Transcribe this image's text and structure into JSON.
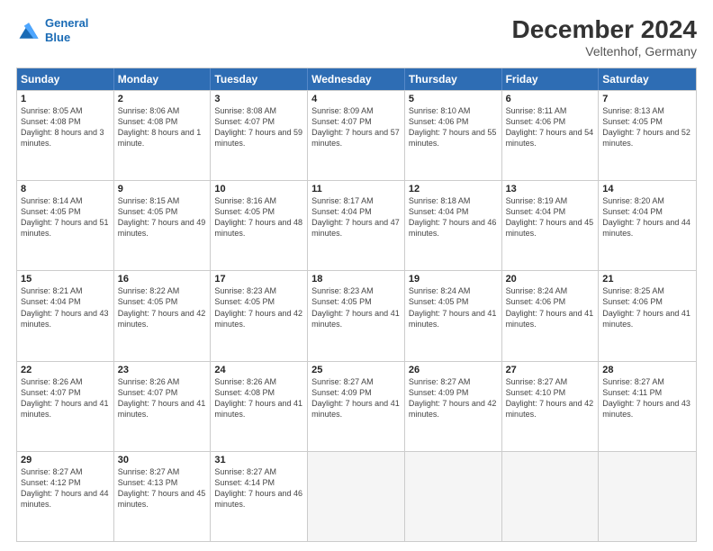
{
  "logo": {
    "line1": "General",
    "line2": "Blue"
  },
  "title": "December 2024",
  "location": "Veltenhof, Germany",
  "days_of_week": [
    "Sunday",
    "Monday",
    "Tuesday",
    "Wednesday",
    "Thursday",
    "Friday",
    "Saturday"
  ],
  "weeks": [
    [
      {
        "day": "1",
        "sunrise": "Sunrise: 8:05 AM",
        "sunset": "Sunset: 4:08 PM",
        "daylight": "Daylight: 8 hours and 3 minutes."
      },
      {
        "day": "2",
        "sunrise": "Sunrise: 8:06 AM",
        "sunset": "Sunset: 4:08 PM",
        "daylight": "Daylight: 8 hours and 1 minute."
      },
      {
        "day": "3",
        "sunrise": "Sunrise: 8:08 AM",
        "sunset": "Sunset: 4:07 PM",
        "daylight": "Daylight: 7 hours and 59 minutes."
      },
      {
        "day": "4",
        "sunrise": "Sunrise: 8:09 AM",
        "sunset": "Sunset: 4:07 PM",
        "daylight": "Daylight: 7 hours and 57 minutes."
      },
      {
        "day": "5",
        "sunrise": "Sunrise: 8:10 AM",
        "sunset": "Sunset: 4:06 PM",
        "daylight": "Daylight: 7 hours and 55 minutes."
      },
      {
        "day": "6",
        "sunrise": "Sunrise: 8:11 AM",
        "sunset": "Sunset: 4:06 PM",
        "daylight": "Daylight: 7 hours and 54 minutes."
      },
      {
        "day": "7",
        "sunrise": "Sunrise: 8:13 AM",
        "sunset": "Sunset: 4:05 PM",
        "daylight": "Daylight: 7 hours and 52 minutes."
      }
    ],
    [
      {
        "day": "8",
        "sunrise": "Sunrise: 8:14 AM",
        "sunset": "Sunset: 4:05 PM",
        "daylight": "Daylight: 7 hours and 51 minutes."
      },
      {
        "day": "9",
        "sunrise": "Sunrise: 8:15 AM",
        "sunset": "Sunset: 4:05 PM",
        "daylight": "Daylight: 7 hours and 49 minutes."
      },
      {
        "day": "10",
        "sunrise": "Sunrise: 8:16 AM",
        "sunset": "Sunset: 4:05 PM",
        "daylight": "Daylight: 7 hours and 48 minutes."
      },
      {
        "day": "11",
        "sunrise": "Sunrise: 8:17 AM",
        "sunset": "Sunset: 4:04 PM",
        "daylight": "Daylight: 7 hours and 47 minutes."
      },
      {
        "day": "12",
        "sunrise": "Sunrise: 8:18 AM",
        "sunset": "Sunset: 4:04 PM",
        "daylight": "Daylight: 7 hours and 46 minutes."
      },
      {
        "day": "13",
        "sunrise": "Sunrise: 8:19 AM",
        "sunset": "Sunset: 4:04 PM",
        "daylight": "Daylight: 7 hours and 45 minutes."
      },
      {
        "day": "14",
        "sunrise": "Sunrise: 8:20 AM",
        "sunset": "Sunset: 4:04 PM",
        "daylight": "Daylight: 7 hours and 44 minutes."
      }
    ],
    [
      {
        "day": "15",
        "sunrise": "Sunrise: 8:21 AM",
        "sunset": "Sunset: 4:04 PM",
        "daylight": "Daylight: 7 hours and 43 minutes."
      },
      {
        "day": "16",
        "sunrise": "Sunrise: 8:22 AM",
        "sunset": "Sunset: 4:05 PM",
        "daylight": "Daylight: 7 hours and 42 minutes."
      },
      {
        "day": "17",
        "sunrise": "Sunrise: 8:23 AM",
        "sunset": "Sunset: 4:05 PM",
        "daylight": "Daylight: 7 hours and 42 minutes."
      },
      {
        "day": "18",
        "sunrise": "Sunrise: 8:23 AM",
        "sunset": "Sunset: 4:05 PM",
        "daylight": "Daylight: 7 hours and 41 minutes."
      },
      {
        "day": "19",
        "sunrise": "Sunrise: 8:24 AM",
        "sunset": "Sunset: 4:05 PM",
        "daylight": "Daylight: 7 hours and 41 minutes."
      },
      {
        "day": "20",
        "sunrise": "Sunrise: 8:24 AM",
        "sunset": "Sunset: 4:06 PM",
        "daylight": "Daylight: 7 hours and 41 minutes."
      },
      {
        "day": "21",
        "sunrise": "Sunrise: 8:25 AM",
        "sunset": "Sunset: 4:06 PM",
        "daylight": "Daylight: 7 hours and 41 minutes."
      }
    ],
    [
      {
        "day": "22",
        "sunrise": "Sunrise: 8:26 AM",
        "sunset": "Sunset: 4:07 PM",
        "daylight": "Daylight: 7 hours and 41 minutes."
      },
      {
        "day": "23",
        "sunrise": "Sunrise: 8:26 AM",
        "sunset": "Sunset: 4:07 PM",
        "daylight": "Daylight: 7 hours and 41 minutes."
      },
      {
        "day": "24",
        "sunrise": "Sunrise: 8:26 AM",
        "sunset": "Sunset: 4:08 PM",
        "daylight": "Daylight: 7 hours and 41 minutes."
      },
      {
        "day": "25",
        "sunrise": "Sunrise: 8:27 AM",
        "sunset": "Sunset: 4:09 PM",
        "daylight": "Daylight: 7 hours and 41 minutes."
      },
      {
        "day": "26",
        "sunrise": "Sunrise: 8:27 AM",
        "sunset": "Sunset: 4:09 PM",
        "daylight": "Daylight: 7 hours and 42 minutes."
      },
      {
        "day": "27",
        "sunrise": "Sunrise: 8:27 AM",
        "sunset": "Sunset: 4:10 PM",
        "daylight": "Daylight: 7 hours and 42 minutes."
      },
      {
        "day": "28",
        "sunrise": "Sunrise: 8:27 AM",
        "sunset": "Sunset: 4:11 PM",
        "daylight": "Daylight: 7 hours and 43 minutes."
      }
    ],
    [
      {
        "day": "29",
        "sunrise": "Sunrise: 8:27 AM",
        "sunset": "Sunset: 4:12 PM",
        "daylight": "Daylight: 7 hours and 44 minutes."
      },
      {
        "day": "30",
        "sunrise": "Sunrise: 8:27 AM",
        "sunset": "Sunset: 4:13 PM",
        "daylight": "Daylight: 7 hours and 45 minutes."
      },
      {
        "day": "31",
        "sunrise": "Sunrise: 8:27 AM",
        "sunset": "Sunset: 4:14 PM",
        "daylight": "Daylight: 7 hours and 46 minutes."
      },
      null,
      null,
      null,
      null
    ]
  ]
}
